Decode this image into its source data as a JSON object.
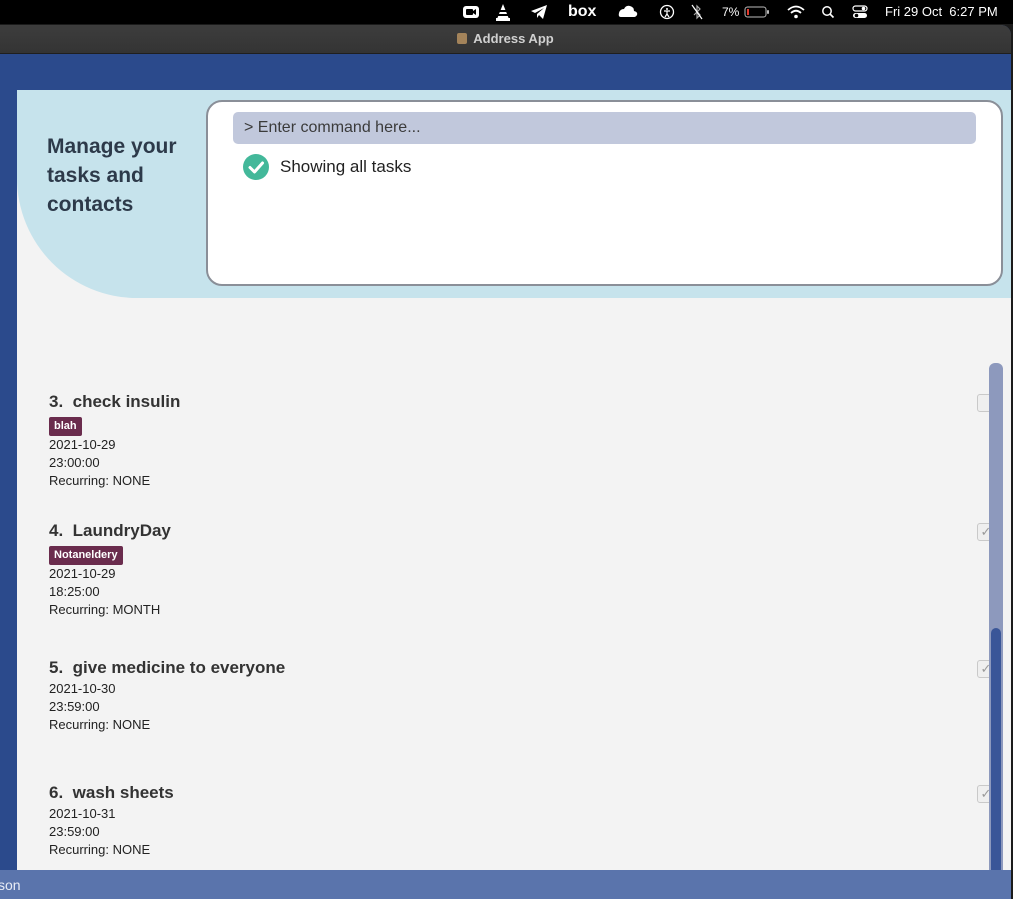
{
  "menubar": {
    "battery": "7%",
    "datetime": "Fri 29 Oct  6:27 PM",
    "icons": [
      "zoom-icon",
      "vlc-icon",
      "telegram-icon",
      "box-icon",
      "cloud-icon",
      "accessibility-icon",
      "bluetooth-off-icon",
      "battery-icon",
      "wifi-icon",
      "search-icon",
      "control-center-icon"
    ],
    "box_label": "box"
  },
  "window": {
    "title": "Address App"
  },
  "header": {
    "tagline": "Manage your tasks and contacts"
  },
  "command": {
    "placeholder": "> Enter command here...",
    "status": "Showing all tasks"
  },
  "tasks": [
    {
      "index": "3.",
      "name": "check insulin",
      "tag": "blah",
      "date": "2021-10-29",
      "time": "23:00:00",
      "recurring": "Recurring: NONE",
      "done": false
    },
    {
      "index": "4.",
      "name": "LaundryDay",
      "tag": "Notaneldery",
      "date": "2021-10-29",
      "time": "18:25:00",
      "recurring": "Recurring: MONTH",
      "done": true
    },
    {
      "index": "5.",
      "name": "give medicine to everyone",
      "tag": null,
      "date": "2021-10-30",
      "time": "23:59:00",
      "recurring": "Recurring: NONE",
      "done": true
    },
    {
      "index": "6.",
      "name": "wash sheets",
      "tag": null,
      "date": "2021-10-31",
      "time": "23:59:00",
      "recurring": "Recurring: NONE",
      "done": true
    }
  ],
  "statusbar": {
    "text": "son"
  },
  "colors": {
    "window_blue": "#2b4a8c",
    "header_teal": "#c6e3ec",
    "tag": "#6a2c4d",
    "check": "#43b89a",
    "scroll_thumb": "#3a5698"
  }
}
